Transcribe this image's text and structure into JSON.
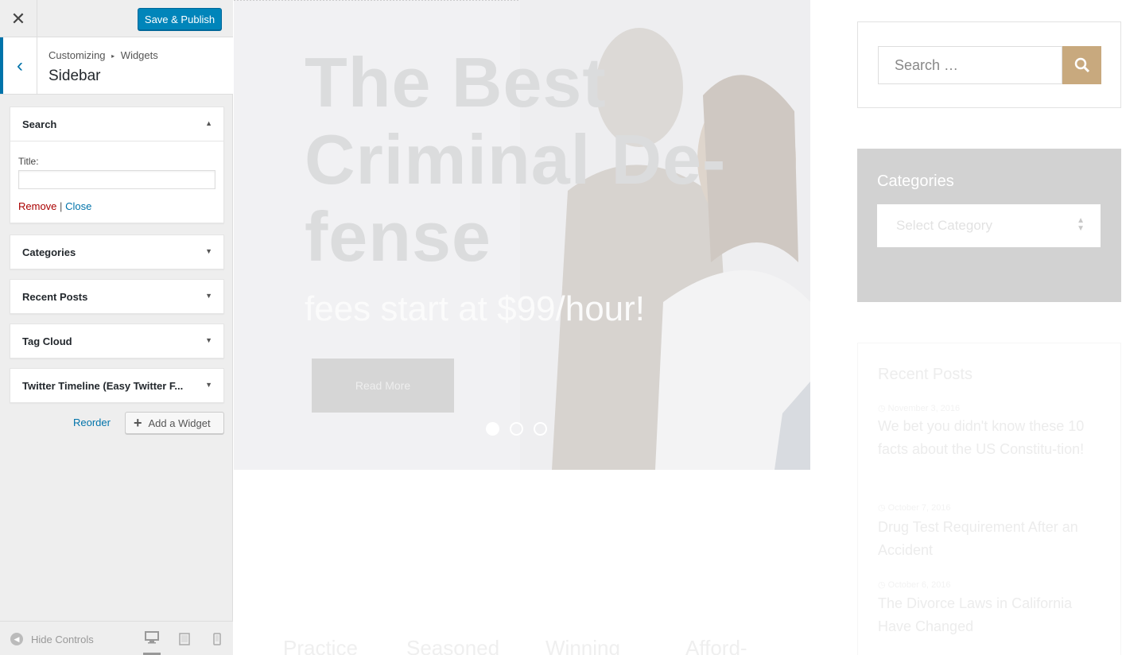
{
  "topbar": {
    "close_icon": "close-icon",
    "save_label": "Save & Publish"
  },
  "section": {
    "crumb_1": "Customizing",
    "crumb_2": "Widgets",
    "title": "Sidebar"
  },
  "widgets": [
    {
      "title": "Search",
      "expanded": true,
      "field_label": "Title:",
      "field_value": "",
      "remove": "Remove",
      "separator": "|",
      "close": "Close"
    },
    {
      "title": "Categories",
      "expanded": false
    },
    {
      "title": "Recent Posts",
      "expanded": false
    },
    {
      "title": "Tag Cloud",
      "expanded": false
    },
    {
      "title": "Twitter Timeline (Easy Twitter F...",
      "expanded": false
    }
  ],
  "actions": {
    "reorder": "Reorder",
    "add_widget": "Add a Widget"
  },
  "footer": {
    "hide_controls": "Hide Controls",
    "devices": [
      "desktop",
      "tablet",
      "mobile"
    ],
    "active_device": "desktop"
  },
  "preview": {
    "hero": {
      "title": "The Best Criminal De-fense",
      "subtitle": "fees start at $99/hour!",
      "button": "Read More",
      "slides": 3,
      "active_slide": 1
    },
    "sidebar": {
      "search_placeholder": "Search …",
      "categories_title": "Categories",
      "categories_select": "Select Category",
      "recent_title": "Recent Posts",
      "posts": [
        {
          "date": "November 3, 2016",
          "title": "We bet you didn't know these 10 facts about the US Constitu-tion!"
        },
        {
          "date": "October 7, 2016",
          "title": "Drug Test Requirement After an Accident"
        },
        {
          "date": "October 6, 2016",
          "title": "The Divorce Laws in California Have Changed"
        }
      ]
    },
    "features": [
      "Practice",
      "Seasoned",
      "Winning",
      "Afford-"
    ]
  },
  "colors": {
    "primary": "#0085ba",
    "accent": "#c8a97e",
    "link": "#0073aa",
    "remove": "#aa0000"
  }
}
